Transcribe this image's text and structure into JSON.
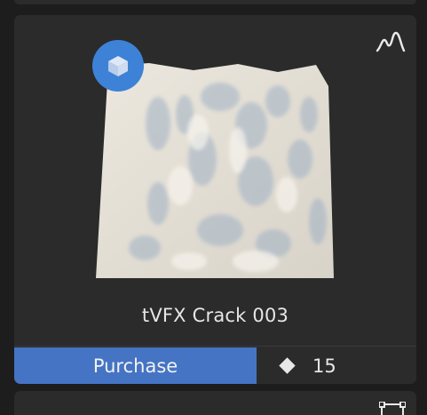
{
  "asset": {
    "title": "tVFX Crack 003",
    "purchase_label": "Purchase",
    "price": "15",
    "badge_icon": "cube-icon",
    "corner_icon": "heightmap-icon",
    "accent_color": "#4574c4"
  },
  "next_asset": {
    "corner_icon": "bounding-box-icon"
  }
}
